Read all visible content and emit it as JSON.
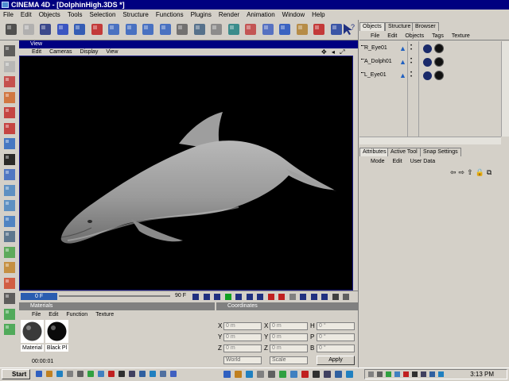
{
  "window": {
    "title": "CINEMA 4D - [DolphinHigh.3DS *]"
  },
  "menu": [
    "File",
    "Edit",
    "Objects",
    "Tools",
    "Selection",
    "Structure",
    "Functions",
    "Plugins",
    "Render",
    "Animation",
    "Window",
    "Help"
  ],
  "toolbar_icons": [
    "undo-icon",
    "redo-icon",
    "select-arrow-icon",
    "move-icon",
    "scale-icon",
    "rotate-icon",
    "x-axis-icon",
    "y-axis-icon",
    "z-axis-icon",
    "coordinate-system-icon",
    "model-tool-icon",
    "object-tool-icon",
    "texture-tool-icon",
    "point-tool-icon",
    "edge-tool-icon",
    "polygon-tool-icon",
    "render-view-icon",
    "render-picture-viewer-icon",
    "render-settings-icon",
    "primitive-cube-icon",
    "nurbs-icon",
    "deformer-icon",
    "scene-icon",
    "light-icon",
    "help-cursor-icon"
  ],
  "view": {
    "title": "View",
    "menu": [
      "Edit",
      "Cameras",
      "Display",
      "View"
    ]
  },
  "timeline": {
    "current": "0 F",
    "end": "90 F"
  },
  "objects_panel": {
    "tabs": [
      "Objects",
      "Structure",
      "Browser"
    ],
    "menu": [
      "File",
      "Edit",
      "Objects",
      "Tags",
      "Texture"
    ],
    "items": [
      {
        "name": "R_Eye01"
      },
      {
        "name": "A_Dolph01"
      },
      {
        "name": "L_Eye01"
      }
    ]
  },
  "attributes_panel": {
    "tabs": [
      "Attributes",
      "Active Tool",
      "Snap Settings"
    ],
    "menu": [
      "Mode",
      "Edit",
      "User Data"
    ]
  },
  "materials": {
    "title": "Materials",
    "menu": [
      "File",
      "Edit",
      "Function",
      "Texture"
    ],
    "items": [
      {
        "name": "Material",
        "color": "#3a3a3a"
      },
      {
        "name": "Black Pl",
        "color": "#0a0a0a"
      }
    ]
  },
  "coordinates": {
    "title": "Coordinates",
    "position": {
      "x": "0 m",
      "y": "0 m",
      "z": "0 m"
    },
    "size": {
      "x": "0 m",
      "y": "0 m",
      "z": "0 m"
    },
    "rotation": {
      "h": "0 °",
      "p": "0 °",
      "b": "0 °"
    },
    "mode_select": "World",
    "size_select": "Scale",
    "apply": "Apply"
  },
  "status": {
    "time": "00:00:01"
  },
  "taskbar": {
    "start": "Start",
    "clock": "3:13 PM"
  },
  "colors": {
    "title_blue": "#000080",
    "viewport_bg": "#000000",
    "dolphin": "#a8a8a8"
  }
}
